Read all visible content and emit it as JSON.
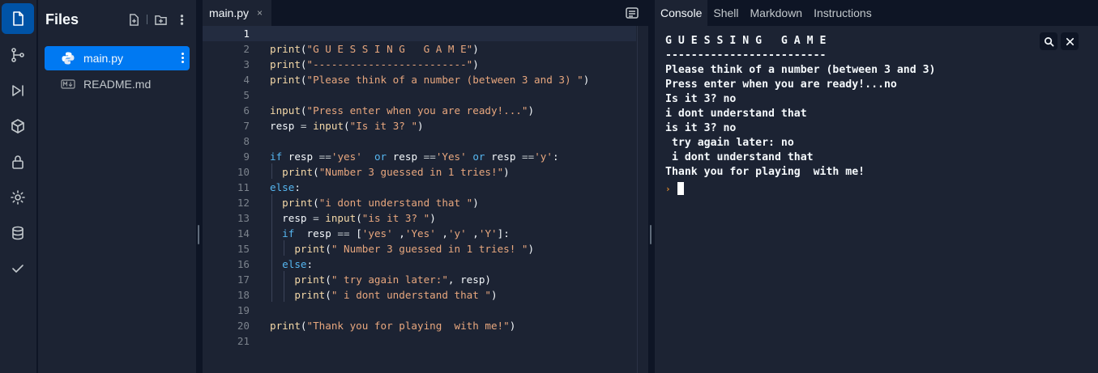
{
  "activity_bar": {
    "items": [
      "files-icon",
      "git-branch-icon",
      "run-debug-icon",
      "package-icon",
      "lock-icon",
      "gear-icon",
      "database-icon",
      "check-icon"
    ]
  },
  "files_panel": {
    "title": "Files",
    "items": [
      {
        "name": "main.py",
        "icon": "python-icon",
        "active": true
      },
      {
        "name": "README.md",
        "icon": "markdown-icon",
        "active": false
      }
    ]
  },
  "editor": {
    "tab_label": "main.py",
    "tab_close": "×",
    "lines": [
      {
        "n": "1",
        "text": ""
      },
      {
        "n": "2",
        "text": "print(\"G U E S S I N G   G A M E\")"
      },
      {
        "n": "3",
        "text": "print(\"-------------------------\")"
      },
      {
        "n": "4",
        "text": "print(\"Please think of a number (between 3 and 3) \")"
      },
      {
        "n": "5",
        "text": ""
      },
      {
        "n": "6",
        "text": "input(\"Press enter when you are ready!...\")"
      },
      {
        "n": "7",
        "text": "resp = input(\"Is it 3? \")"
      },
      {
        "n": "8",
        "text": ""
      },
      {
        "n": "9",
        "text": "if resp =='yes'  or resp =='Yes' or resp =='y':"
      },
      {
        "n": "10",
        "text": "  print(\"Number 3 guessed in 1 tries!\")"
      },
      {
        "n": "11",
        "text": "else:"
      },
      {
        "n": "12",
        "text": "  print(\"i dont understand that \")"
      },
      {
        "n": "13",
        "text": "  resp = input(\"is it 3? \")"
      },
      {
        "n": "14",
        "text": "  if  resp == ['yes' ,'Yes' ,'y' ,'Y']:"
      },
      {
        "n": "15",
        "text": "    print(\" Number 3 guessed in 1 tries! \")"
      },
      {
        "n": "16",
        "text": "  else:"
      },
      {
        "n": "17",
        "text": "    print(\" try again later:\", resp)"
      },
      {
        "n": "18",
        "text": "    print(\" i dont understand that \")"
      },
      {
        "n": "19",
        "text": ""
      },
      {
        "n": "20",
        "text": "print(\"Thank you for playing  with me!\")"
      },
      {
        "n": "21",
        "text": ""
      }
    ]
  },
  "console": {
    "tabs": [
      "Console",
      "Shell",
      "Markdown",
      "Instructions"
    ],
    "active_tab": "Console",
    "output": [
      "G U E S S I N G   G A M E",
      "-------------------------",
      "Please think of a number (between 3 and 3)",
      "Press enter when you are ready!...no",
      "Is it 3? no",
      "i dont understand that",
      "is it 3? no",
      " try again later: no",
      " i dont understand that",
      "Thank you for playing  with me!"
    ],
    "prompt": "›"
  },
  "colors": {
    "accent": "#0079f2",
    "background": "#0e1525",
    "panel": "#1c2333",
    "keyword": "#56b6f0",
    "string": "#e8a77e",
    "function": "#f5d9a8"
  }
}
